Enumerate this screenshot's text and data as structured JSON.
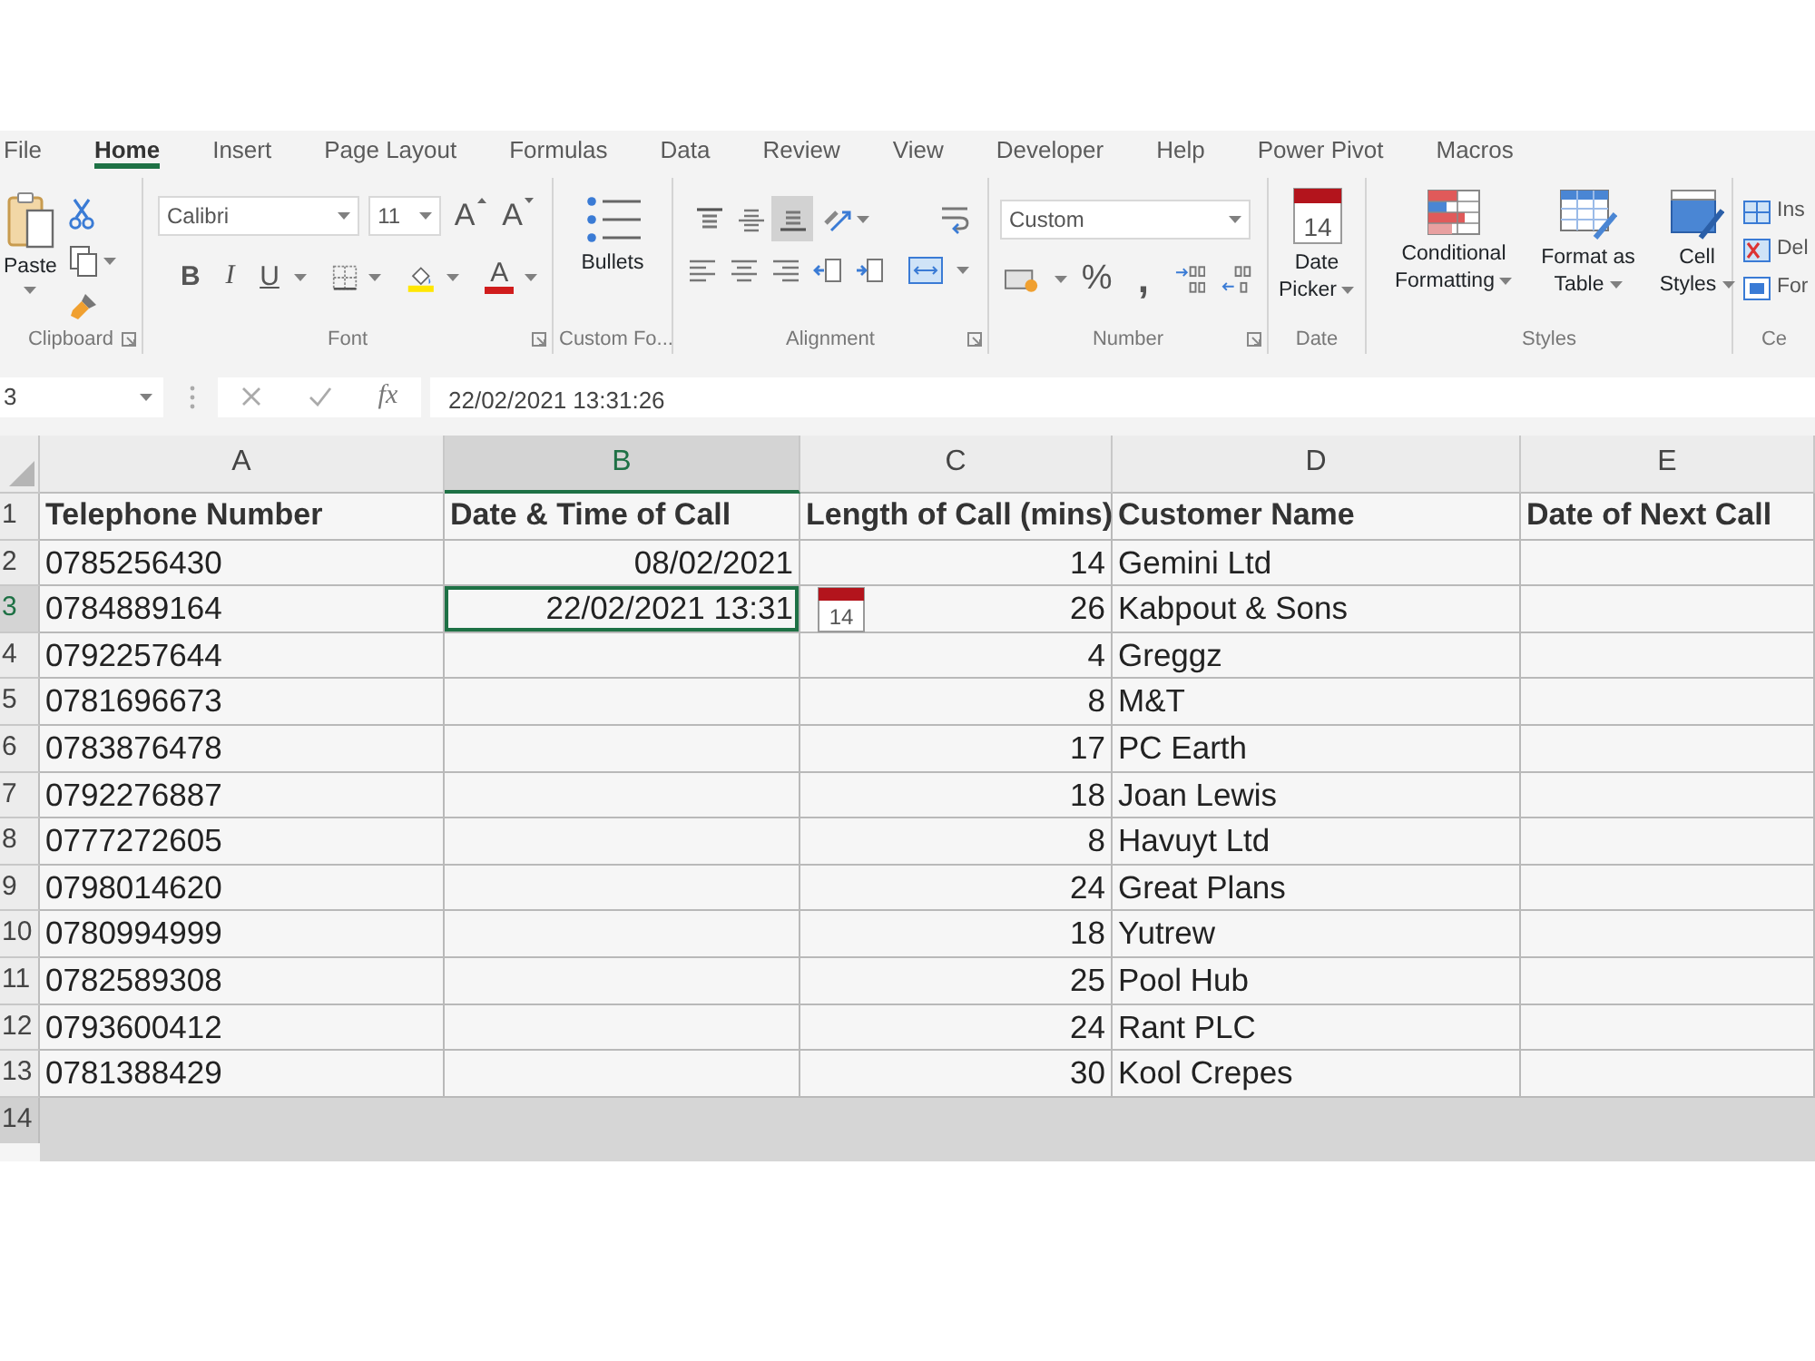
{
  "tabs": [
    {
      "label": "File",
      "selected": false
    },
    {
      "label": "Home",
      "selected": true
    },
    {
      "label": "Insert",
      "selected": false
    },
    {
      "label": "Page Layout",
      "selected": false
    },
    {
      "label": "Formulas",
      "selected": false
    },
    {
      "label": "Data",
      "selected": false
    },
    {
      "label": "Review",
      "selected": false
    },
    {
      "label": "View",
      "selected": false
    },
    {
      "label": "Developer",
      "selected": false
    },
    {
      "label": "Help",
      "selected": false
    },
    {
      "label": "Power Pivot",
      "selected": false
    },
    {
      "label": "Macros",
      "selected": false
    }
  ],
  "ribbon_groups": [
    {
      "kind": "clipboard",
      "label": "Clipboard",
      "launcher": true,
      "paste_label": "Paste"
    },
    {
      "kind": "font",
      "label": "Font",
      "launcher": true,
      "font_name": "Calibri",
      "font_size": "11",
      "grow_glyph": "A",
      "shrink_glyph": "A",
      "bold_glyph": "B",
      "italic_glyph": "I",
      "underline_glyph": "U",
      "font_color_glyph": "A"
    },
    {
      "kind": "bullets",
      "label": "Custom Fo...",
      "launcher": false,
      "button_label": "Bullets"
    },
    {
      "kind": "alignment",
      "label": "Alignment",
      "launcher": true,
      "vertical": [
        {
          "kind": "top",
          "selected": false
        },
        {
          "kind": "middle",
          "selected": false
        },
        {
          "kind": "bottom",
          "selected": true
        }
      ]
    },
    {
      "kind": "number",
      "label": "Number",
      "launcher": true,
      "format": "Custom",
      "percent_glyph": "%",
      "comma_glyph": ","
    },
    {
      "kind": "date",
      "label": "Date",
      "launcher": false,
      "button_label": "Date Picker",
      "calendar_day": "14"
    },
    {
      "kind": "styles",
      "label": "Styles",
      "launcher": false,
      "buttons": [
        "Conditional Formatting",
        "Format as Table",
        "Cell Styles"
      ]
    },
    {
      "kind": "cells",
      "label": "Ce",
      "launcher": false,
      "buttons": [
        "Ins",
        "Del",
        "For"
      ]
    }
  ],
  "formula_bar": {
    "name_box": "3",
    "function_glyph": "fx",
    "formula": "22/02/2021 13:31:26"
  },
  "sheet": {
    "columns": [
      {
        "label": "A",
        "selected": false,
        "kind": "text"
      },
      {
        "label": "B",
        "selected": true,
        "kind": "number"
      },
      {
        "label": "C",
        "selected": false,
        "kind": "number"
      },
      {
        "label": "D",
        "selected": false,
        "kind": "text"
      },
      {
        "label": "E",
        "selected": false,
        "kind": "text"
      }
    ],
    "rows": [
      {
        "number": "1",
        "selected": false,
        "kind": "header",
        "cells": [
          "Telephone Number",
          "Date & Time of Call",
          "Length of Call (mins)",
          "Customer Name",
          "Date of Next Call"
        ]
      },
      {
        "number": "2",
        "selected": false,
        "kind": "data",
        "cells": [
          "0785256430",
          "08/02/2021",
          "14",
          "Gemini Ltd",
          null
        ]
      },
      {
        "number": "3",
        "selected": true,
        "kind": "data",
        "cells": [
          "0784889164",
          "22/02/2021 13:31",
          "26",
          "Kabpout & Sons",
          null
        ]
      },
      {
        "number": "4",
        "selected": false,
        "kind": "data",
        "cells": [
          "0792257644",
          null,
          "4",
          "Greggz",
          null
        ]
      },
      {
        "number": "5",
        "selected": false,
        "kind": "data",
        "cells": [
          "0781696673",
          null,
          "8",
          "M&T",
          null
        ]
      },
      {
        "number": "6",
        "selected": false,
        "kind": "data",
        "cells": [
          "0783876478",
          null,
          "17",
          "PC Earth",
          null
        ]
      },
      {
        "number": "7",
        "selected": false,
        "kind": "data",
        "cells": [
          "0792276887",
          null,
          "18",
          "Joan Lewis",
          null
        ]
      },
      {
        "number": "8",
        "selected": false,
        "kind": "data",
        "cells": [
          "0777272605",
          null,
          "8",
          "Havuyt Ltd",
          null
        ]
      },
      {
        "number": "9",
        "selected": false,
        "kind": "data",
        "cells": [
          "0798014620",
          null,
          "24",
          "Great Plans",
          null
        ]
      },
      {
        "number": "10",
        "selected": false,
        "kind": "data",
        "cells": [
          "0780994999",
          null,
          "18",
          "Yutrew",
          null
        ]
      },
      {
        "number": "11",
        "selected": false,
        "kind": "data",
        "cells": [
          "0782589308",
          null,
          "25",
          "Pool Hub",
          null
        ]
      },
      {
        "number": "12",
        "selected": false,
        "kind": "data",
        "cells": [
          "0793600412",
          null,
          "24",
          "Rant PLC",
          null
        ]
      },
      {
        "number": "13",
        "selected": false,
        "kind": "data",
        "cells": [
          "0781388429",
          null,
          "30",
          "Kool Crepes",
          null
        ]
      }
    ],
    "empty_rows": [
      "14"
    ],
    "date_picker_day": "14"
  }
}
